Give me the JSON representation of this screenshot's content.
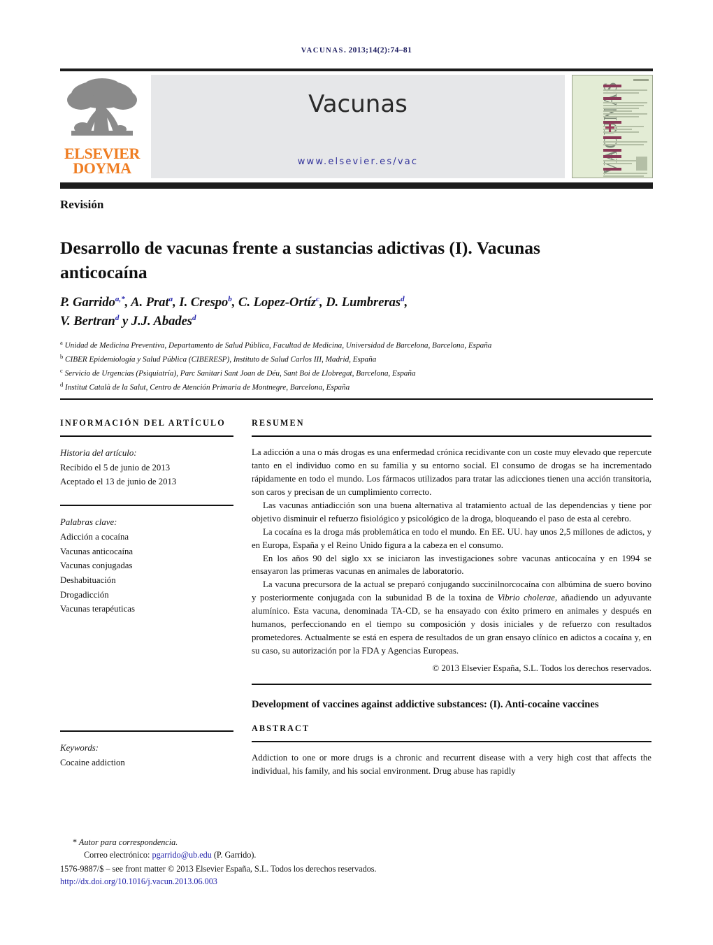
{
  "citation": {
    "journal_smallcaps": "VACUNAS",
    "rest": ". 2013;14(2):74–81"
  },
  "masthead": {
    "publisher_line1": "ELSEVIER",
    "publisher_line2": "DOYMA",
    "journal_title": "Vacunas",
    "journal_url": "www.elsevier.es/vac",
    "cover_title": "VACUNAS"
  },
  "article": {
    "type": "Revisión",
    "title": "Desarrollo de vacunas frente a sustancias adictivas (I). Vacunas anticocaína",
    "title_en": "Development of vaccines against addictive substances: (I). Anti-cocaine vaccines"
  },
  "authors": [
    {
      "name": "P. Garrido",
      "sup": "a,*"
    },
    {
      "name": "A. Prat",
      "sup": "a"
    },
    {
      "name": "I. Crespo",
      "sup": "b"
    },
    {
      "name": "C. Lopez-Ortíz",
      "sup": "c"
    },
    {
      "name": "D. Lumbreras",
      "sup": "d"
    },
    {
      "name": "V. Bertran",
      "sup": "d"
    },
    {
      "name": "J.J. Abades",
      "sup": "d"
    }
  ],
  "affiliations": [
    {
      "mark": "a",
      "text": "Unidad de Medicina Preventiva, Departamento de Salud Pública, Facultad de Medicina, Universidad de Barcelona, Barcelona, España"
    },
    {
      "mark": "b",
      "text": "CIBER Epidemiología y Salud Pública (CIBERESP), Instituto de Salud Carlos III, Madrid, España"
    },
    {
      "mark": "c",
      "text": "Servicio de Urgencias (Psiquiatría), Parc Sanitari Sant Joan de Déu, Sant Boi de Llobregat, Barcelona, España"
    },
    {
      "mark": "d",
      "text": "Institut Català de la Salut, Centro de Atención Primaria de Montnegre, Barcelona, España"
    }
  ],
  "info_column": {
    "heading": "INFORMACIÓN DEL ARTÍCULO",
    "history_label": "Historia del artículo:",
    "history_lines": [
      "Recibido el 5 de junio de 2013",
      "Aceptado el 13 de junio de 2013"
    ],
    "keywords_label": "Palabras clave:",
    "keywords": [
      "Adicción a cocaína",
      "Vacunas anticocaína",
      "Vacunas conjugadas",
      "Deshabituación",
      "Drogadicción",
      "Vacunas terapéuticas"
    ],
    "keywords_en_label": "Keywords:",
    "keywords_en": [
      "Cocaine addiction"
    ]
  },
  "resumen": {
    "heading": "RESUMEN",
    "paragraphs": [
      "La adicción a una o más drogas es una enfermedad crónica recidivante con un coste muy elevado que repercute tanto en el individuo como en su familia y su entorno social. El consumo de drogas se ha incrementado rápidamente en todo el mundo. Los fármacos utilizados para tratar las adicciones tienen una acción transitoria, son caros y precisan de un cumplimiento correcto.",
      "Las vacunas antiadicción son una buena alternativa al tratamiento actual de las dependencias y tiene por objetivo disminuir el refuerzo fisiológico y psicológico de la droga, bloqueando el paso de esta al cerebro.",
      "La cocaína es la droga más problemática en todo el mundo. En EE. UU. hay unos 2,5 millones de adictos, y en Europa, España y el Reino Unido figura a la cabeza en el consumo.",
      "En los años 90 del siglo xx se iniciaron las investigaciones sobre vacunas anticocaína y en 1994 se ensayaron las primeras vacunas en animales de laboratorio."
    ],
    "final_paragraph_parts": [
      "La vacuna precursora de la actual se preparó conjugando succinilnorcocaína con albúmina de suero bovino y posteriormente conjugada con la subunidad B de la toxina de ",
      "Vibrio cholerae",
      ", añadiendo un adyuvante alumínico. Esta vacuna, denominada TA-CD, se ha ensayado con éxito primero en animales y después en humanos, perfeccionando en el tiempo su composición y dosis iniciales y de refuerzo con resultados prometedores. Actualmente se está en espera de resultados de un gran ensayo clínico en adictos a cocaína y, en su caso, su autorización por la FDA y Agencias Europeas."
    ],
    "copyright": "© 2013 Elsevier España, S.L. Todos los derechos reservados."
  },
  "abstract": {
    "heading": "ABSTRACT",
    "paragraphs": [
      "Addiction to one or more drugs is a chronic and recurrent disease with a very high cost that affects the individual, his family, and his social environment. Drug abuse has rapidly"
    ]
  },
  "footer": {
    "corresponding_star": "*",
    "corresponding_label": "Autor para correspondencia.",
    "email_label": "Correo electrónico:",
    "email": "pgarrido@ub.edu",
    "email_owner": "(P. Garrido).",
    "front_matter": "1576-9887/$ – see front matter © 2013 Elsevier España, S.L. Todos los derechos reservados.",
    "doi": "http://dx.doi.org/10.1016/j.vacun.2013.06.003"
  },
  "colors": {
    "link": "#2222aa",
    "elsevier_orange": "#ef7d22",
    "banner_gray": "#e6e7e9",
    "cover_green": "#e3ecd5",
    "rule_dark": "#1c1c1c"
  }
}
